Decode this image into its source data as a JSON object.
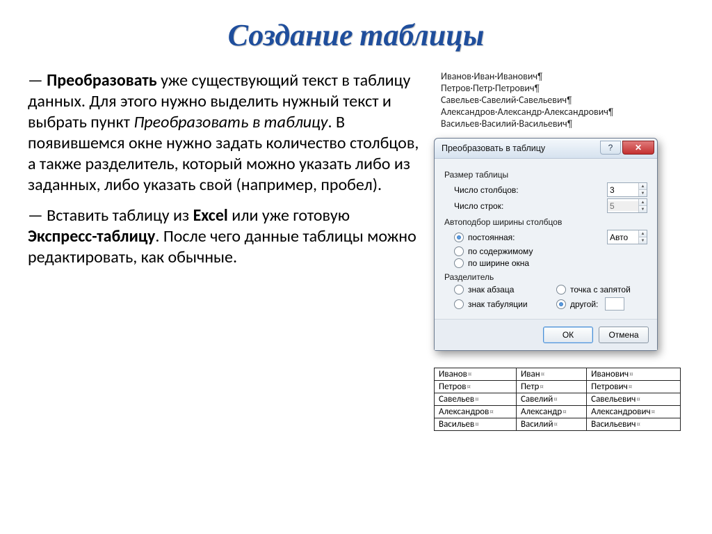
{
  "title": "Создание таблицы",
  "paragraph1_prefix": "— ",
  "paragraph1_bold": "Преобразовать",
  "paragraph1_rest1": " уже существующий текст в таблицу данных. Для этого нужно выделить нужный текст и выбрать пункт ",
  "paragraph1_italic": "Преобразовать в таблицу",
  "paragraph1_rest2": ". В появившемся окне нужно задать количество столбцов, а также разделитель, который  можно указать либо из заданных, либо указать свой (например, пробел).",
  "paragraph2_prefix": "— Вставить таблицу из ",
  "paragraph2_b1": "Excel",
  "paragraph2_mid": " или уже готовую ",
  "paragraph2_b2": "Экспресс-таблицу",
  "paragraph2_rest": ". После чего данные таблицы можно редактировать, как обычные.",
  "names_raw": [
    "Иванов·Иван·Иванович",
    "Петров·Петр·Петрович",
    "Савельев·Савелий·Савельевич",
    "Александров·Александр·Александрович",
    "Васильев·Василий·Васильевич"
  ],
  "dialog": {
    "title": "Преобразовать в таблицу",
    "group_size": "Размер таблицы",
    "cols_label": "Число столбцов:",
    "cols_value": "3",
    "rows_label": "Число строк:",
    "rows_value": "5",
    "group_autowidth": "Автоподбор ширины столбцов",
    "opt_fixed": "постоянная:",
    "opt_fixed_val": "Авто",
    "opt_content": "по содержимому",
    "opt_window": "по ширине окна",
    "group_sep": "Разделитель",
    "sep_para": "знак абзаца",
    "sep_semicolon": "точка с запятой",
    "sep_tab": "знак табуляции",
    "sep_other": "другой:",
    "btn_ok": "ОК",
    "btn_cancel": "Отмена"
  },
  "result_rows": [
    [
      "Иванов",
      "Иван",
      "Иванович"
    ],
    [
      "Петров",
      "Петр",
      "Петрович"
    ],
    [
      "Савельев",
      "Савелий",
      "Савельевич"
    ],
    [
      "Александров",
      "Александр",
      "Александрович"
    ],
    [
      "Васильев",
      "Василий",
      "Васильевич"
    ]
  ]
}
